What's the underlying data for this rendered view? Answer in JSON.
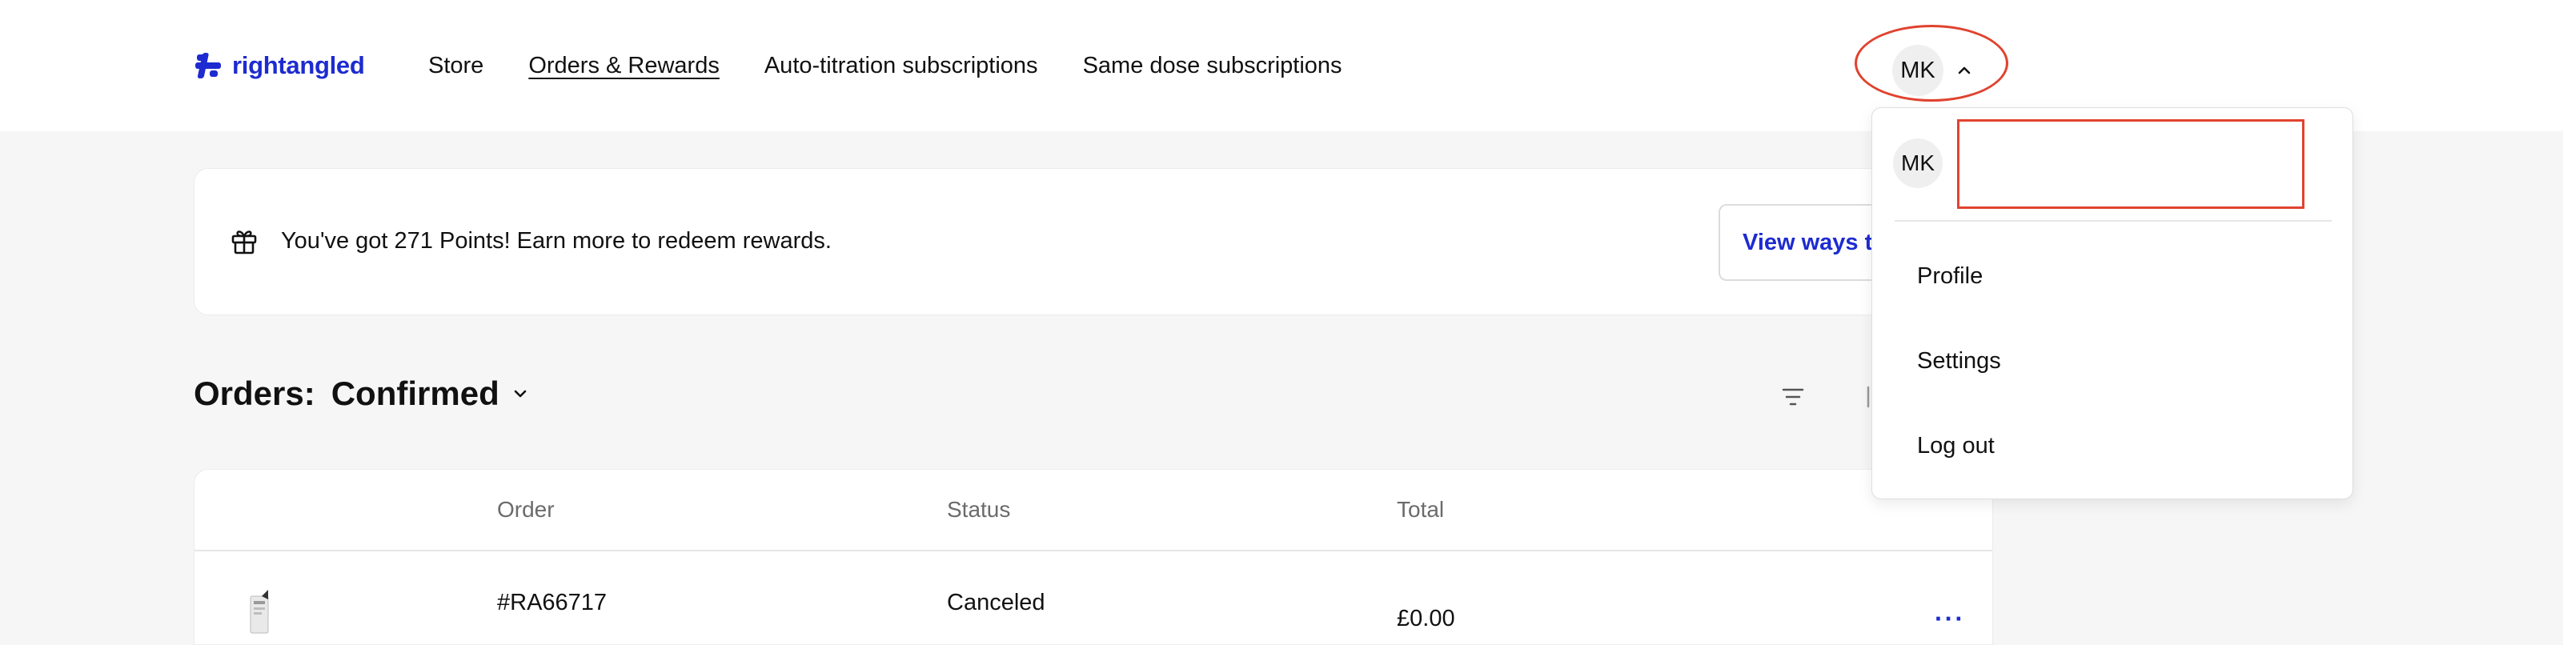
{
  "brand": {
    "name": "rightangled",
    "color": "#1d2bd1"
  },
  "nav": {
    "items": [
      {
        "label": "Store"
      },
      {
        "label": "Orders & Rewards"
      },
      {
        "label": "Auto-titration subscriptions"
      },
      {
        "label": "Same dose subscriptions"
      }
    ],
    "active": "Orders & Rewards"
  },
  "user": {
    "initials": "MK"
  },
  "rewards": {
    "message": "You've got 271 Points! Earn more to redeem rewards.",
    "button_label": "View ways to"
  },
  "orders": {
    "label": "Orders:",
    "filter_value": "Confirmed",
    "columns": [
      "Order",
      "Status",
      "Total"
    ],
    "rows": [
      {
        "order": "#RA66717",
        "status": "Canceled",
        "total": "£0.00",
        "more": "···"
      }
    ]
  },
  "dropdown": {
    "initials": "MK",
    "items": [
      {
        "label": "Profile"
      },
      {
        "label": "Settings"
      },
      {
        "label": "Log out"
      }
    ]
  },
  "icons": {
    "logo": "rightangled-logo-icon",
    "gift": "gift-icon",
    "filter": "filter-icon",
    "sort": "sort-icon",
    "chevron_up": "chevron-up-icon",
    "chevron_down": "chevron-down-icon",
    "more": "more-icon"
  },
  "colors": {
    "annotation": "#e0432f",
    "page_bg": "#f6f6f6"
  }
}
